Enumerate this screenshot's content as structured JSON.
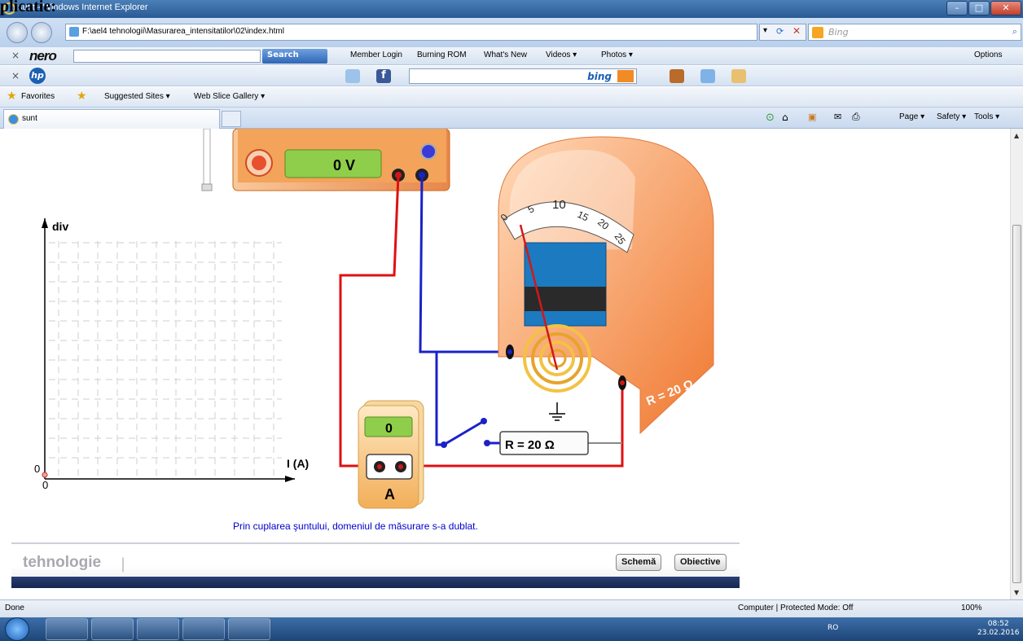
{
  "page_heading": "plicatie:",
  "window": {
    "title": "sunt - Windows Internet Explorer",
    "address": "F:\\ael4 tehnologii\\Masurarea_intensitatilor\\02\\index.html",
    "search_placeholder": "Bing"
  },
  "nero_toolbar": {
    "logo": "nero",
    "search_button": "Search",
    "items": [
      "Member Login",
      "Burning ROM",
      "What's New",
      "Videos ▾",
      "Photos ▾"
    ],
    "options": "Options"
  },
  "hp_toolbar": {
    "logo": "hp",
    "search_brand": "bing"
  },
  "favorites_bar": {
    "favorites": "Favorites",
    "items": [
      "Suggested Sites ▾",
      "Web Slice Gallery ▾"
    ]
  },
  "tabs": [
    {
      "label": "sunt"
    }
  ],
  "command_bar": [
    "Page ▾",
    "Safety ▾",
    "Tools ▾"
  ],
  "simulation": {
    "voltage_display": "0 V",
    "ammeter_display": "0",
    "ammeter_label": "A",
    "resistor_label": "R = 20 Ω",
    "meter_resistance_label": "R = 20 Ω",
    "scale_ticks": [
      "0",
      "5",
      "10",
      "15",
      "20",
      "25"
    ],
    "graph": {
      "y_label": "div",
      "x_label": "I (A)",
      "origin_y": "0",
      "origin_x": "0"
    },
    "message": "Prin cuplarea şuntului, domeniul de măsurare s-a dublat.",
    "brand": "tehnologie",
    "buttons": {
      "scheme": "Schemă",
      "objectives": "Obiective"
    },
    "colors": {
      "positive_wire": "#e01010",
      "negative_wire": "#1a22c8",
      "case_orange": "#f0a04a"
    }
  },
  "status_bar": {
    "status": "Done",
    "zone": "Computer | Protected Mode: Off",
    "zoom": "100%"
  },
  "taskbar": {
    "language": "RO",
    "time": "08:52",
    "date": "23.02.2016"
  }
}
